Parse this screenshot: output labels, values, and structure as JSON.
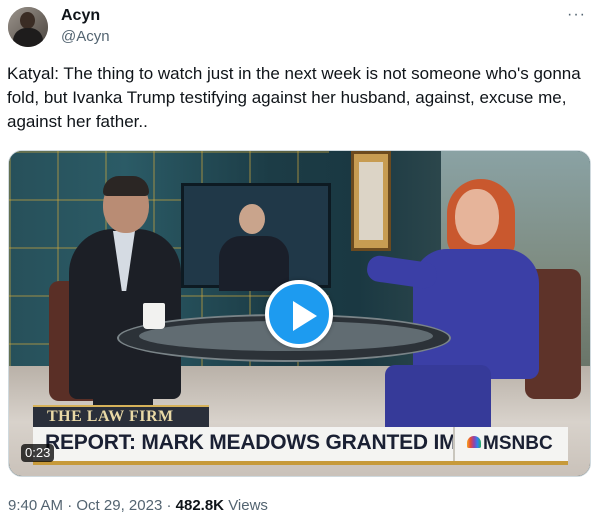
{
  "author": {
    "name": "Acyn",
    "handle": "@Acyn"
  },
  "more_icon": "more-horizontal-icon",
  "tweet": {
    "text": "Katyal: The thing to watch just in the next week is not someone who's gonna fold, but Ivanka Trump testifying against her husband, against, excuse me, against her father.."
  },
  "video": {
    "play_icon": "play-icon",
    "duration": "0:23",
    "show_label": "THE LAW FIRM",
    "headline": "REPORT: MARK MEADOWS GRANTED IMMUNITY",
    "network": "MSNBC"
  },
  "meta": {
    "time": "9:40 AM",
    "separator": "·",
    "date": "Oct 29, 2023",
    "views_count": "482.8K",
    "views_label": "Views"
  },
  "colors": {
    "accent": "#1d9bf0",
    "text_primary": "#0f1419",
    "text_secondary": "#536471"
  }
}
